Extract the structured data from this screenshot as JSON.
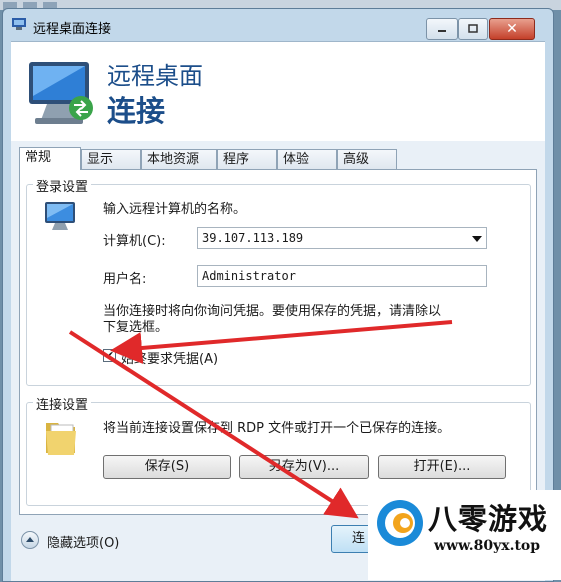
{
  "window": {
    "title": "远程桌面连接"
  },
  "header": {
    "line1": "远程桌面",
    "line2": "连接"
  },
  "tabs": [
    {
      "label": "常规",
      "active": true
    },
    {
      "label": "显示"
    },
    {
      "label": "本地资源"
    },
    {
      "label": "程序"
    },
    {
      "label": "体验"
    },
    {
      "label": "高级"
    }
  ],
  "login": {
    "group_title": "登录设置",
    "instruction": "输入远程计算机的名称。",
    "computer_label": "计算机(C):",
    "computer_value": "39.107.113.189",
    "username_label": "用户名:",
    "username_value": "Administrator",
    "prompt_line1": "当你连接时将向你询问凭据。要使用保存的凭据，请清除以",
    "prompt_line2": "下复选框。",
    "always_ask_label": "始终要求凭据(A)",
    "always_ask_checked": true
  },
  "connection": {
    "group_title": "连接设置",
    "description": "将当前连接设置保存到 RDP 文件或打开一个已保存的连接。",
    "save_label": "保存(S)",
    "save_as_label": "另存为(V)...",
    "open_label": "打开(E)..."
  },
  "footer": {
    "hide_options_label": "隐藏选项(O)",
    "connect_label": "连"
  },
  "watermark": {
    "name": "八零游戏",
    "url": "www.80yx.top"
  },
  "colors": {
    "header_title": "#1c4e8a",
    "arrow": "#e0292a"
  }
}
